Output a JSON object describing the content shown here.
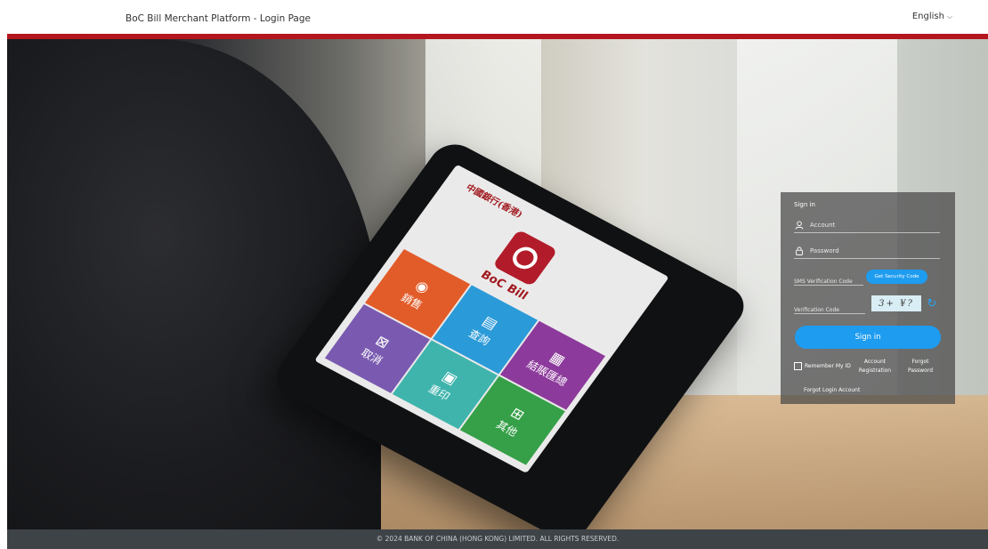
{
  "header": {
    "title": "BoC Bill Merchant Platform - Login Page",
    "language": "English"
  },
  "hero": {
    "device": {
      "bank_name": "中國銀行(香港)",
      "app_name": "BoC Bill",
      "tiles": [
        {
          "label": "銷售",
          "icon": "coin-icon",
          "color": "#e25c2a"
        },
        {
          "label": "查詢",
          "icon": "receipt-icon",
          "color": "#2b9ad8"
        },
        {
          "label": "結賬匯總",
          "icon": "report-icon",
          "color": "#8c3a9b"
        },
        {
          "label": "取消",
          "icon": "cancel-icon",
          "color": "#7a5ab0"
        },
        {
          "label": "重印",
          "icon": "printer-icon",
          "color": "#3fb4ad"
        },
        {
          "label": "其他",
          "icon": "grid-icon",
          "color": "#36a048"
        }
      ]
    }
  },
  "login": {
    "title": "Sign in",
    "account_placeholder": "Account",
    "password_placeholder": "Password",
    "sms_placeholder": "SMS Verification Code",
    "get_code_label": "Get Security Code",
    "verification_placeholder": "Verification Code",
    "captcha_text": "3+ ¥?",
    "sign_in_label": "Sign in",
    "remember_label": "Remember My ID",
    "account_registration_label": "Account Registration",
    "forgot_password_label": "Forgot Password",
    "forgot_account_label": "Forgot Login Account"
  },
  "footer": {
    "copyright": "© 2024 BANK OF CHINA (HONG KONG) LIMITED. ALL RIGHTS RESERVED."
  },
  "colors": {
    "brand_red": "#b4161f",
    "accent_blue": "#1e9cf0",
    "footer_bg": "#3e4347"
  }
}
